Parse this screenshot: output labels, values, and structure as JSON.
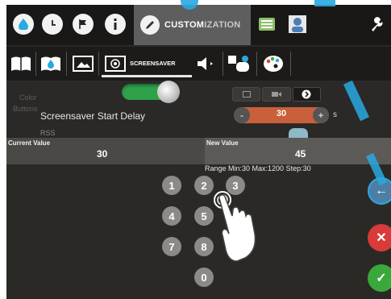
{
  "topbar": {
    "icons": [
      "water-drop-icon",
      "clock-icon",
      "flag-icon",
      "info-icon"
    ],
    "active_tab": {
      "label_main": "CUSTOM",
      "label_fade": "IZATION"
    },
    "right_icons": [
      "recipe-icon",
      "user-profile-icon",
      "wrench-icon"
    ]
  },
  "subbar": {
    "icons": [
      "book-icon",
      "book-water-icon",
      "image-icon"
    ],
    "active_tab": {
      "label": "SCREENSAVER"
    },
    "right_icons": [
      "speaker-icon",
      "cloud-sun-icon",
      "palette-icon"
    ]
  },
  "settings": {
    "ghost_labels": [
      "Color",
      "Buttons"
    ],
    "delay": {
      "label": "Screensaver Start Delay",
      "value": "30",
      "minus": "-",
      "plus": "+",
      "unit": "s"
    },
    "rss_label": "RSS"
  },
  "values": {
    "current_label": "Current Value",
    "current_value": "30",
    "new_label": "New Value",
    "new_value": "45",
    "range": "Range Min:30 Max:1200 Step:30"
  },
  "keypad": {
    "keys": [
      "1",
      "2",
      "3",
      "4",
      "5",
      "7",
      "8",
      "0"
    ]
  },
  "actions": {
    "back": "←",
    "cancel": "✕",
    "confirm": "✓"
  },
  "colors": {
    "accent_blue": "#28a9e1",
    "toggle_green": "#2fa14a",
    "stepper_orange": "#c9603b",
    "cancel_red": "#d93a3a",
    "confirm_green": "#3aa83a"
  }
}
